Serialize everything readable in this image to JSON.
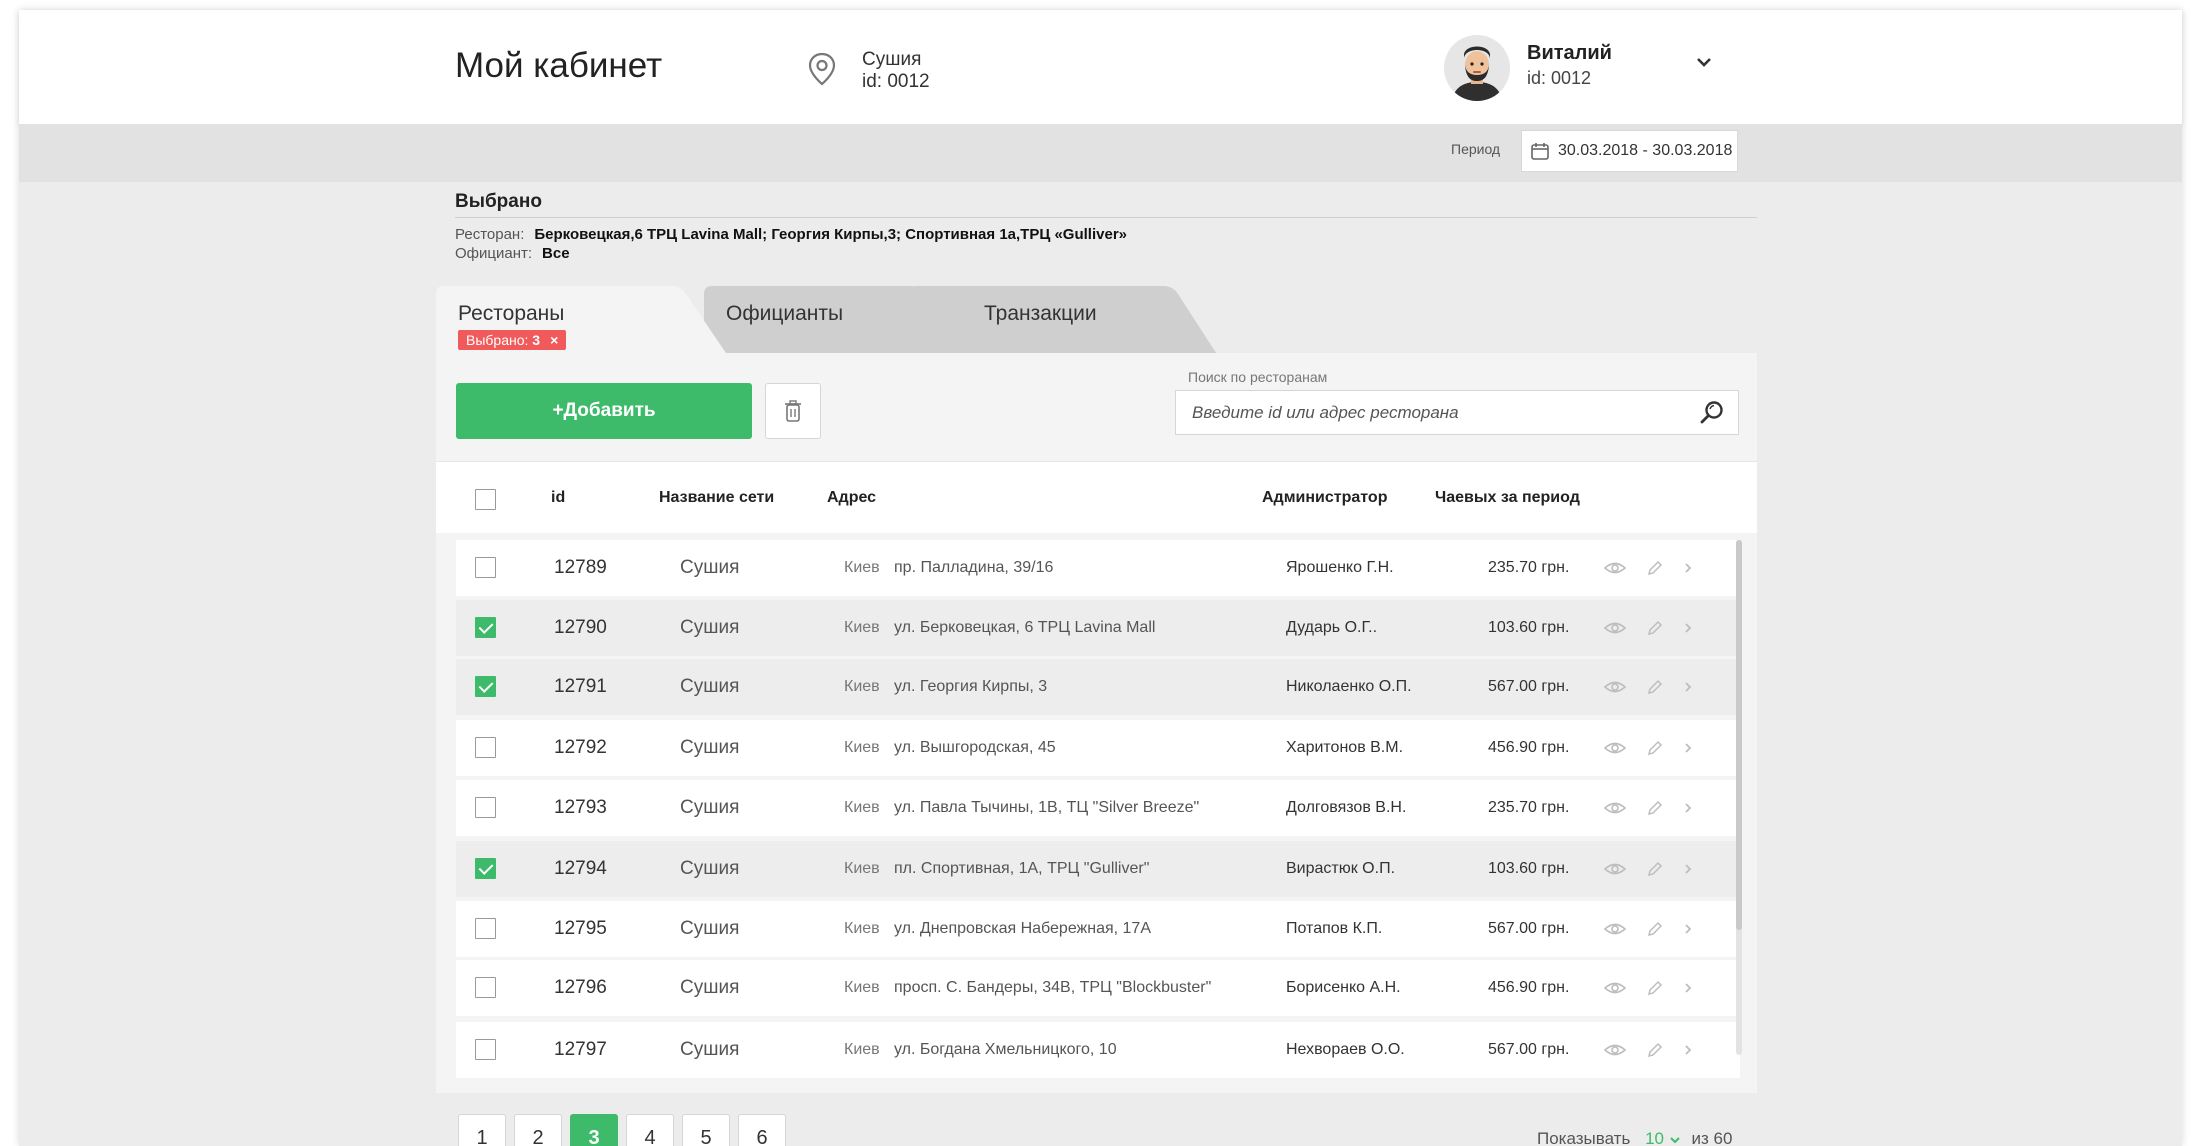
{
  "header": {
    "title": "Мой кабинет",
    "place_name": "Сушия",
    "place_id": "id: 0012",
    "user_name": "Виталий",
    "user_id": "id: 0012"
  },
  "period": {
    "label": "Период",
    "value": "30.03.2018 - 30.03.2018"
  },
  "selected": {
    "title": "Выбрано",
    "restaurant_label": "Ресторан:",
    "restaurant_value": "Берковецкая,6 ТРЦ Lavina Mall; Георгия Кирпы,3; Спортивная 1а,ТРЦ «Gulliver»",
    "waiter_label": "Официант:",
    "waiter_value": "Все"
  },
  "tabs": [
    {
      "label": "Рестораны",
      "active": true,
      "badge_text": "Выбрано: ",
      "badge_count": "3",
      "badge_close": "×"
    },
    {
      "label": "Официанты",
      "active": false
    },
    {
      "label": "Транзакции",
      "active": false
    }
  ],
  "toolbar": {
    "add_label": "+Добавить",
    "search_label": "Поиск по ресторанам",
    "search_placeholder": "Введите id или адрес ресторана"
  },
  "table": {
    "columns": [
      "id",
      "Название сети",
      "Адрес",
      "Администратор",
      "Чаевых за период"
    ],
    "rows": [
      {
        "checked": false,
        "id": "12789",
        "network": "Сушия",
        "city": "Киев",
        "address": "пр. Палладина, 39/16",
        "admin": "Ярошенко Г.Н.",
        "tips": "235.70 грн."
      },
      {
        "checked": true,
        "id": "12790",
        "network": "Сушия",
        "city": "Киев",
        "address": "ул. Берковецкая, 6 ТРЦ Lavina Mall",
        "admin": "Дударь О.Г..",
        "tips": "103.60 грн."
      },
      {
        "checked": true,
        "id": "12791",
        "network": "Сушия",
        "city": "Киев",
        "address": "ул. Георгия Кирпы, 3",
        "admin": "Николаенко О.П.",
        "tips": "567.00 грн."
      },
      {
        "checked": false,
        "id": "12792",
        "network": "Сушия",
        "city": "Киев",
        "address": "ул. Вышгородская, 45",
        "admin": "Харитонов В.М.",
        "tips": "456.90 грн."
      },
      {
        "checked": false,
        "id": "12793",
        "network": "Сушия",
        "city": "Киев",
        "address": "ул. Павла Тычины, 1В, ТЦ \"Silver Breeze\"",
        "admin": "Долговязов В.Н.",
        "tips": "235.70 грн."
      },
      {
        "checked": true,
        "id": "12794",
        "network": "Сушия",
        "city": "Киев",
        "address": "пл. Спортивная, 1А, ТРЦ \"Gulliver\"",
        "admin": "Вирастюк О.П.",
        "tips": "103.60 грн."
      },
      {
        "checked": false,
        "id": "12795",
        "network": "Сушия",
        "city": "Киев",
        "address": "ул. Днепровская Набережная, 17А",
        "admin": "Потапов К.П.",
        "tips": "567.00 грн."
      },
      {
        "checked": false,
        "id": "12796",
        "network": "Сушия",
        "city": "Киев",
        "address": "просп. С. Бандеры, 34В, ТРЦ \"Blockbuster\"",
        "admin": "Борисенко А.Н.",
        "tips": "456.90 грн."
      },
      {
        "checked": false,
        "id": "12797",
        "network": "Сушия",
        "city": "Киев",
        "address": "ул. Богдана Хмельницкого, 10",
        "admin": "Нехвораев О.О.",
        "tips": "567.00 грн."
      }
    ]
  },
  "pagination": {
    "pages": [
      "1",
      "2",
      "3",
      "4",
      "5",
      "6"
    ],
    "current": "3",
    "show_label": "Показывать",
    "per_page": "10",
    "total_prefix": "из",
    "total": "60"
  },
  "colors": {
    "accent": "#3dbb6a",
    "badge": "#f05a5a"
  },
  "icons": [
    "map-pin-icon",
    "chevron-down-icon",
    "calendar-icon",
    "trash-icon",
    "search-icon",
    "eye-icon",
    "pencil-icon",
    "chevron-right-icon"
  ]
}
